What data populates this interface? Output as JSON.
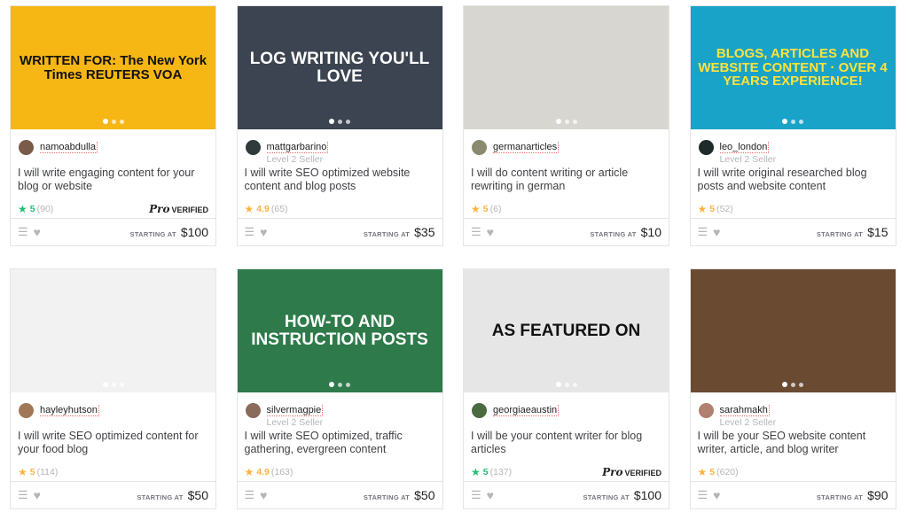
{
  "colors": {
    "green_star": "#1dbf73",
    "gold_star": "#ffb33e",
    "text": "#404145"
  },
  "starting_at": "STARTING AT",
  "pro_label": "Pro",
  "verified_label": "VERIFIED",
  "gigs": [
    {
      "seller": "namoabdulla",
      "level": "",
      "title": "I will write engaging content for your blog or website",
      "rating": "5",
      "reviews": "(90)",
      "star": "green",
      "pro": true,
      "price": "$100",
      "thumb_text": "WRITTEN FOR: The New York Times REUTERS VOA",
      "thumb_bg": "#f6b613",
      "thumb_fg": "#111",
      "avatar": "#7a5a48"
    },
    {
      "seller": "mattgarbarino",
      "level": "Level 2 Seller",
      "title": "I will write SEO optimized website content and blog posts",
      "rating": "4.9",
      "reviews": "(65)",
      "star": "gold",
      "pro": false,
      "price": "$35",
      "thumb_text": "LOG WRITING YOU'LL LOVE",
      "thumb_bg": "#3b4450",
      "thumb_fg": "#fff",
      "avatar": "#2f3a3a"
    },
    {
      "seller": "germanarticles",
      "level": "",
      "title": "I will do content writing or article rewriting in german",
      "rating": "5",
      "reviews": "(6)",
      "star": "gold",
      "pro": false,
      "price": "$10",
      "thumb_text": "",
      "thumb_bg": "#d8d6d0",
      "thumb_fg": "#333",
      "avatar": "#8a8a70"
    },
    {
      "seller": "leo_london",
      "level": "Level 2 Seller",
      "title": "I will write original researched blog posts and website content",
      "rating": "5",
      "reviews": "(52)",
      "star": "gold",
      "pro": false,
      "price": "$15",
      "thumb_text": "BLOGS, ARTICLES AND WEBSITE CONTENT · OVER 4 YEARS EXPERIENCE!",
      "thumb_bg": "#1aa3c8",
      "thumb_fg": "#ffe23a",
      "avatar": "#1f2a2a"
    },
    {
      "seller": "hayleyhutson",
      "level": "",
      "title": "I will write SEO optimized content for your food blog",
      "rating": "5",
      "reviews": "(114)",
      "star": "gold",
      "pro": false,
      "price": "$50",
      "thumb_text": "",
      "thumb_bg": "#f2f2f2",
      "thumb_fg": "#333",
      "avatar": "#a07858"
    },
    {
      "seller": "silvermagpie",
      "level": "Level 2 Seller",
      "title": "I will write SEO optimized, traffic gathering, evergreen content",
      "rating": "4.9",
      "reviews": "(163)",
      "star": "gold",
      "pro": false,
      "price": "$50",
      "thumb_text": "HOW-TO AND INSTRUCTION POSTS",
      "thumb_bg": "#2e7a4a",
      "thumb_fg": "#fff",
      "avatar": "#8a6a5a"
    },
    {
      "seller": "georgiaeaustin",
      "level": "",
      "title": "I will be your content writer for blog articles",
      "rating": "5",
      "reviews": "(137)",
      "star": "green",
      "pro": true,
      "price": "$100",
      "thumb_text": "AS FEATURED ON",
      "thumb_bg": "#e6e6e6",
      "thumb_fg": "#111",
      "avatar": "#4a6a40"
    },
    {
      "seller": "sarahmakh",
      "level": "Level 2 Seller",
      "title": "I will be your SEO website content writer, article, and blog writer",
      "rating": "5",
      "reviews": "(620)",
      "star": "gold",
      "pro": false,
      "price": "$90",
      "thumb_text": "",
      "thumb_bg": "#6b4a32",
      "thumb_fg": "#fff",
      "avatar": "#b08070"
    }
  ]
}
